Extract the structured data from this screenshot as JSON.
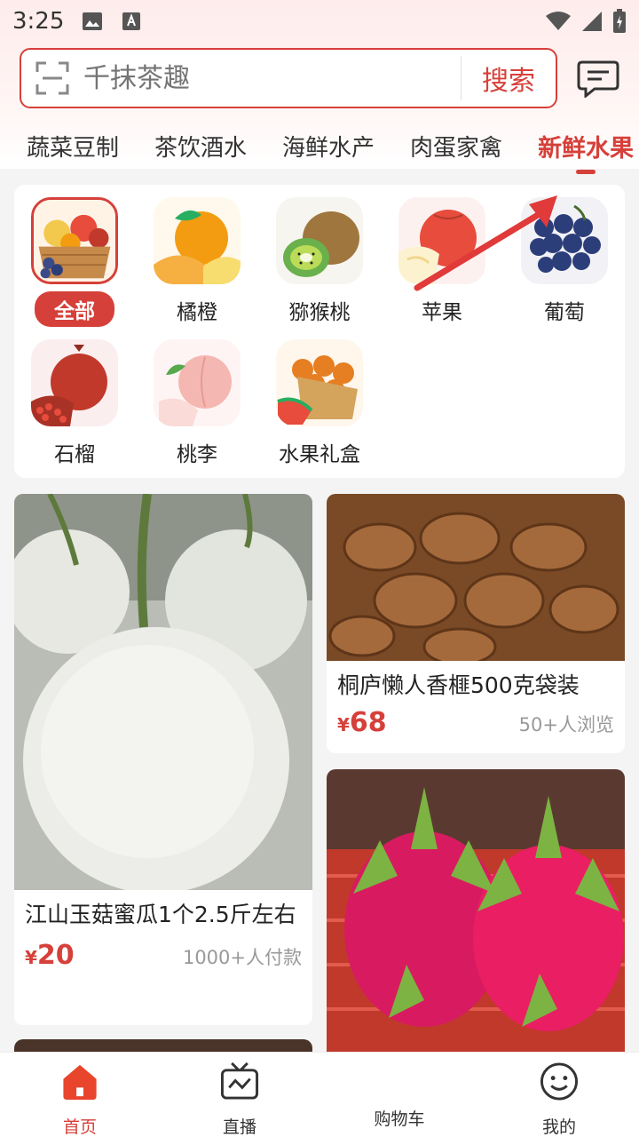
{
  "status_bar": {
    "time": "3:25"
  },
  "search": {
    "placeholder": "千抹茶趣",
    "button_label": "搜索"
  },
  "tabs": [
    {
      "label": "蔬菜豆制"
    },
    {
      "label": "茶饮酒水"
    },
    {
      "label": "海鲜水产"
    },
    {
      "label": "肉蛋家禽"
    },
    {
      "label": "新鲜水果",
      "active": true
    }
  ],
  "fruit_categories": [
    {
      "label": "全部",
      "selected": true
    },
    {
      "label": "橘橙"
    },
    {
      "label": "猕猴桃"
    },
    {
      "label": "苹果"
    },
    {
      "label": "葡萄"
    },
    {
      "label": "石榴"
    },
    {
      "label": "桃李"
    },
    {
      "label": "水果礼盒"
    }
  ],
  "products": [
    {
      "title": "江山玉菇蜜瓜1个2.5斤左右",
      "price_symbol": "¥",
      "price": "20",
      "meta": "1000+人付款"
    },
    {
      "title": "桐庐懒人香榧500克袋装",
      "price_symbol": "¥",
      "price": "68",
      "meta": "50+人浏览"
    },
    {
      "title": ""
    }
  ],
  "bottom_nav": [
    {
      "label": "首页",
      "active": true
    },
    {
      "label": "直播"
    },
    {
      "label": "购物车"
    },
    {
      "label": "我的"
    }
  ],
  "colors": {
    "accent": "#d6403a",
    "background": "#f4f4f4"
  }
}
